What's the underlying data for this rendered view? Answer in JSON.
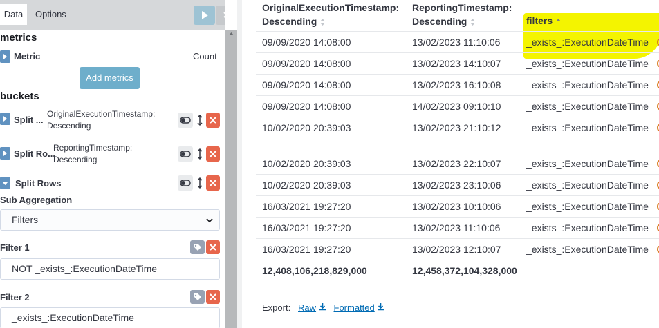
{
  "tabs": {
    "data": "Data",
    "options": "Options"
  },
  "metrics": {
    "title": "metrics",
    "metric_label": "Metric",
    "metric_value": "Count",
    "add_button": "Add metrics"
  },
  "buckets": {
    "title": "buckets",
    "rows": [
      {
        "label": "Split ...",
        "desc": "OriginalExecutionTimestamp: Descending"
      },
      {
        "label": "Split Ro...",
        "desc": "ReportingTimestamp: Descending"
      },
      {
        "label": "Split Rows",
        "desc": ""
      }
    ],
    "sub_aggregation_label": "Sub Aggregation",
    "sub_aggregation_value": "Filters",
    "filter1_label": "Filter 1",
    "filter1_value": "NOT _exists_:ExecutionDateTime",
    "filter2_label": "Filter 2",
    "filter2_value": "_exists_:ExecutionDateTime"
  },
  "table": {
    "headers": [
      {
        "line1": "OriginalExecutionTimestamp:",
        "line2": "Descending"
      },
      {
        "line1": "ReportingTimestamp:",
        "line2": "Descending"
      },
      {
        "line1": "filters",
        "line2": ""
      }
    ],
    "rows": [
      [
        "09/09/2020 14:08:00",
        "13/02/2023 11:10:06",
        "_exists_:ExecutionDateTime"
      ],
      [
        "09/09/2020 14:08:00",
        "13/02/2023 14:10:07",
        "_exists_:ExecutionDateTime"
      ],
      [
        "09/09/2020 14:08:00",
        "13/02/2023 16:10:08",
        "_exists_:ExecutionDateTime"
      ],
      [
        "09/09/2020 14:08:00",
        "14/02/2023 09:10:10",
        "_exists_:ExecutionDateTime"
      ],
      [
        "10/02/2020 20:39:03",
        "13/02/2023 21:10:12",
        "_exists_:ExecutionDateTime"
      ],
      [
        "10/02/2020 20:39:03",
        "13/02/2023 22:10:07",
        "_exists_:ExecutionDateTime"
      ],
      [
        "10/02/2020 20:39:03",
        "13/02/2023 23:10:06",
        "_exists_:ExecutionDateTime"
      ],
      [
        "16/03/2021 19:27:20",
        "13/02/2023 10:10:06",
        "_exists_:ExecutionDateTime"
      ],
      [
        "16/03/2021 19:27:20",
        "13/02/2023 11:10:06",
        "_exists_:ExecutionDateTime"
      ],
      [
        "16/03/2021 19:27:20",
        "13/02/2023 12:10:07",
        "_exists_:ExecutionDateTime"
      ]
    ],
    "totals": [
      "12,408,106,218,829,000",
      "12,458,372,104,328,000"
    ]
  },
  "export": {
    "label": "Export:",
    "raw": "Raw",
    "formatted": "Formatted"
  },
  "colors": {
    "accent": "#6092c0",
    "danger": "#e7664c",
    "highlight": "#f4f400",
    "link": "#006bb4"
  }
}
